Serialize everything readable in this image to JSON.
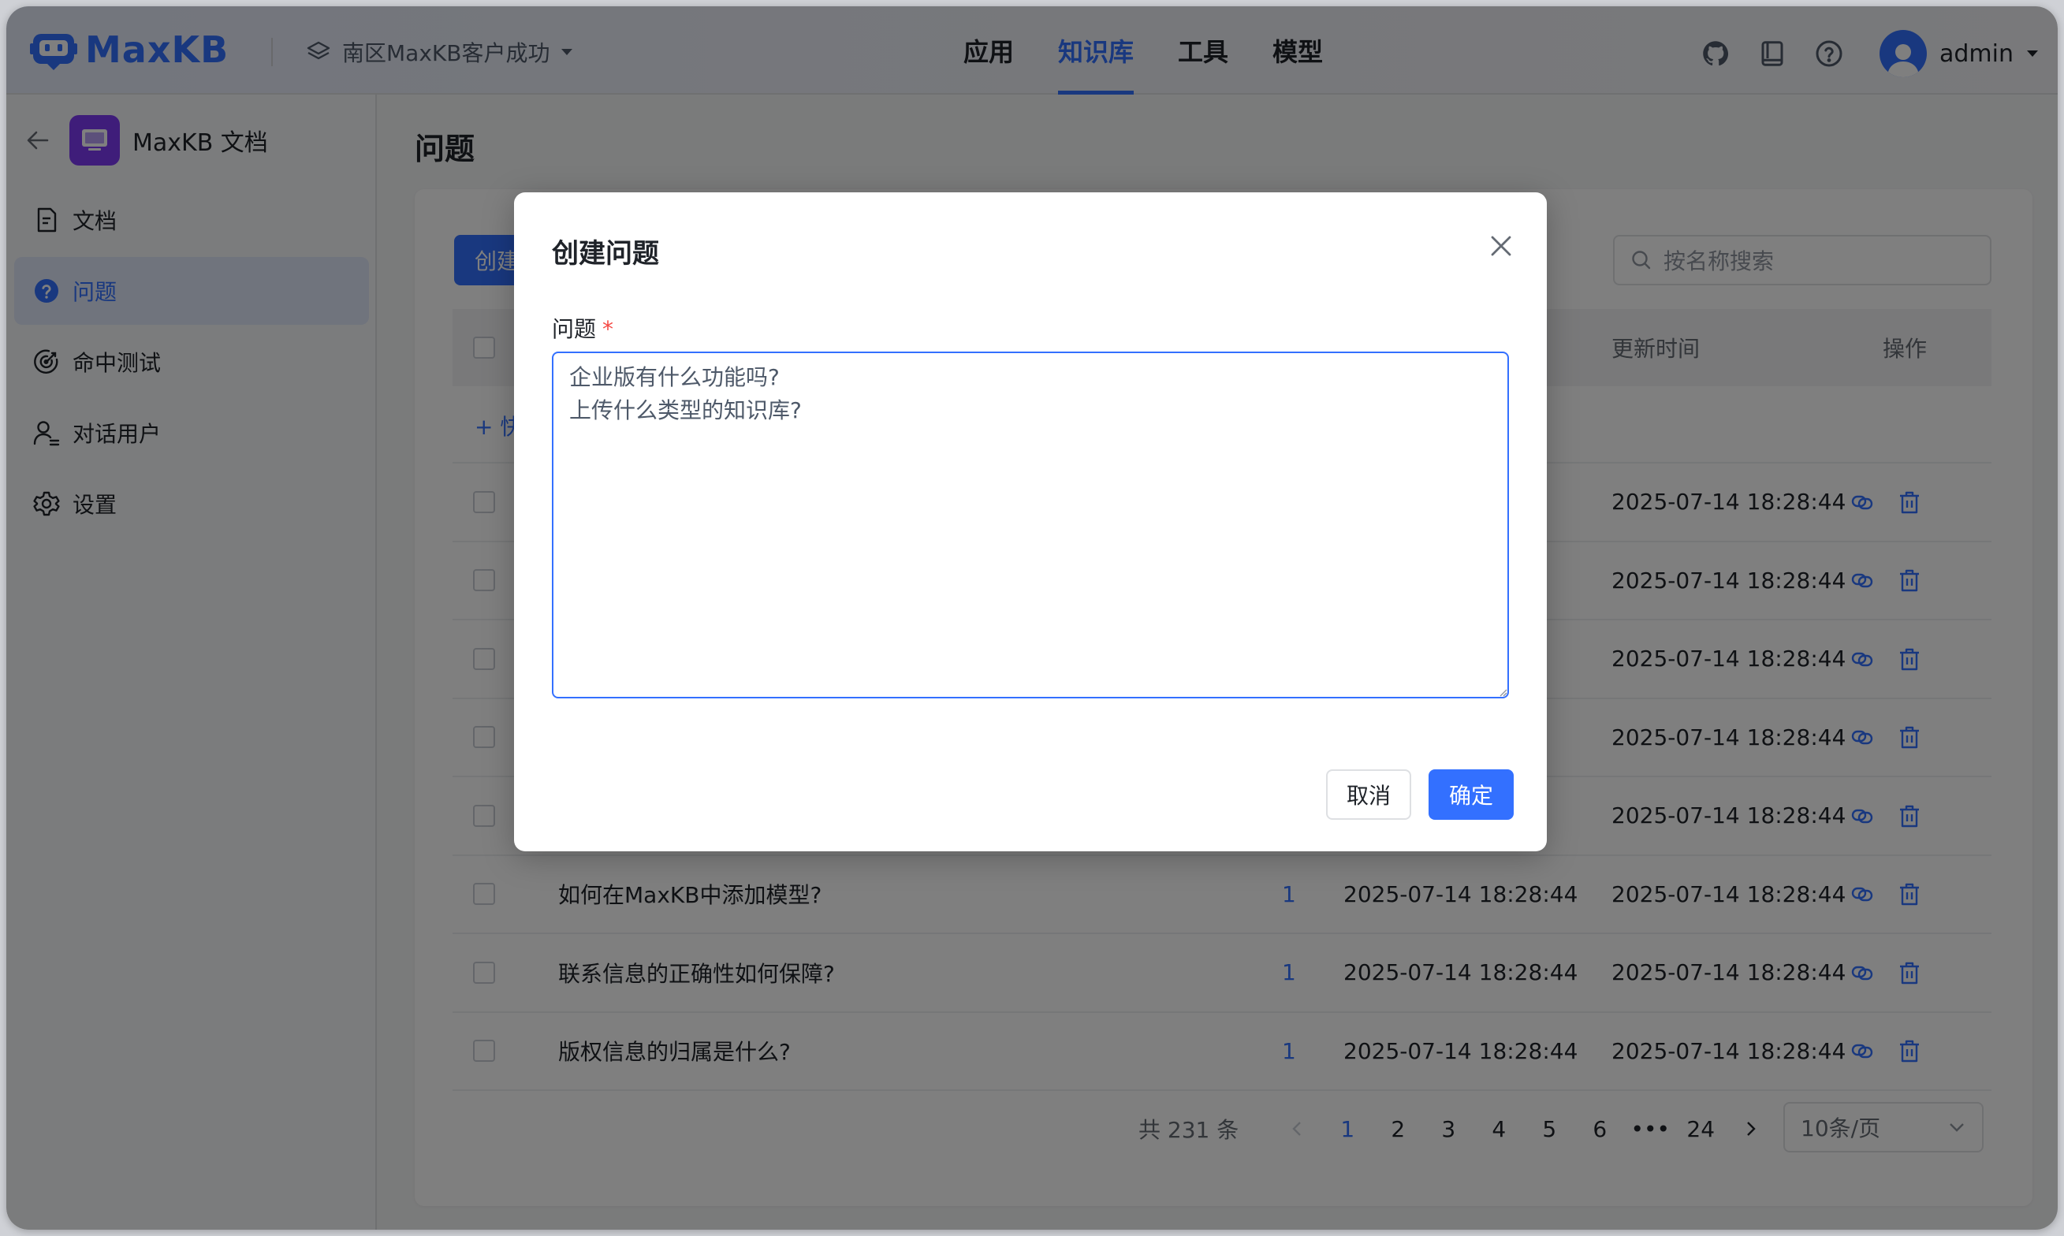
{
  "app": {
    "brand": "MaxKB",
    "workspace": "南区MaxKB客户成功",
    "nav": [
      "应用",
      "知识库",
      "工具",
      "模型"
    ],
    "active_nav": 1,
    "user": "admin"
  },
  "sidebar": {
    "title": "MaxKB 文档",
    "items": [
      {
        "label": "文档",
        "icon": "document-icon"
      },
      {
        "label": "问题",
        "icon": "question-icon"
      },
      {
        "label": "命中测试",
        "icon": "target-icon"
      },
      {
        "label": "对话用户",
        "icon": "users-icon"
      },
      {
        "label": "设置",
        "icon": "gear-icon"
      }
    ],
    "active": 1
  },
  "main": {
    "title": "问题",
    "create_label": "创建问题",
    "search_placeholder": "按名称搜索",
    "columns": {
      "updated": "更新时间",
      "ops": "操作"
    },
    "add_row_label": "+ 快速创建问题",
    "rows": [
      {
        "question": "",
        "count": "",
        "created": "",
        "updated": "2025-07-14 18:28:44"
      },
      {
        "question": "",
        "count": "",
        "created": "",
        "updated": "2025-07-14 18:28:44"
      },
      {
        "question": "",
        "count": "",
        "created": "",
        "updated": "2025-07-14 18:28:44"
      },
      {
        "question": "",
        "count": "",
        "created": "",
        "updated": "2025-07-14 18:28:44"
      },
      {
        "question": "",
        "count": "",
        "created": "",
        "updated": "2025-07-14 18:28:44"
      },
      {
        "question": "如何在MaxKB中添加模型?",
        "count": "1",
        "created": "2025-07-14 18:28:44",
        "updated": "2025-07-14 18:28:44"
      },
      {
        "question": "联系信息的正确性如何保障?",
        "count": "1",
        "created": "2025-07-14 18:28:44",
        "updated": "2025-07-14 18:28:44"
      },
      {
        "question": "版权信息的归属是什么?",
        "count": "1",
        "created": "2025-07-14 18:28:44",
        "updated": "2025-07-14 18:28:44"
      }
    ],
    "pagination": {
      "total": "共 231 条",
      "pages": [
        "1",
        "2",
        "3",
        "4",
        "5",
        "6",
        "•••",
        "24"
      ],
      "current": "1",
      "page_size": "10条/页"
    }
  },
  "modal": {
    "title": "创建问题",
    "field_label": "问题",
    "required_mark": "*",
    "value": "企业版有什么功能吗?\n上传什么类型的知识库?",
    "cancel": "取消",
    "confirm": "确定"
  },
  "colors": {
    "primary": "#3370ff",
    "required": "#f54a45",
    "kb_icon": "#7f3bf5"
  }
}
